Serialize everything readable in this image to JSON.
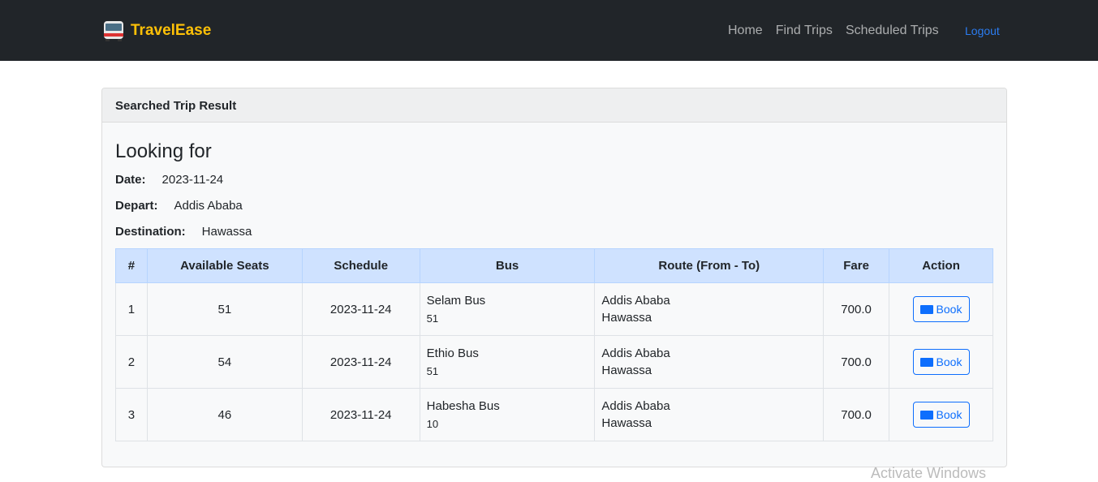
{
  "navbar": {
    "brand": "TravelEase",
    "links": [
      "Home",
      "Find Trips",
      "Scheduled Trips"
    ],
    "logout": "Logout"
  },
  "card": {
    "header": "Searched Trip Result",
    "title": "Looking for",
    "criteria": {
      "date_label": "Date:",
      "date_value": "2023-11-24",
      "depart_label": "Depart:",
      "depart_value": "Addis Ababa",
      "destination_label": "Destination:",
      "destination_value": "Hawassa"
    }
  },
  "table": {
    "headers": [
      "#",
      "Available Seats",
      "Schedule",
      "Bus",
      "Route (From - To)",
      "Fare",
      "Action"
    ],
    "rows": [
      {
        "num": "1",
        "seats": "51",
        "schedule": "2023-11-24",
        "bus": "Selam Bus",
        "bus_sub": "51",
        "from": "Addis Ababa",
        "to": "Hawassa",
        "fare": "700.0",
        "action": "Book"
      },
      {
        "num": "2",
        "seats": "54",
        "schedule": "2023-11-24",
        "bus": "Ethio Bus",
        "bus_sub": "51",
        "from": "Addis Ababa",
        "to": "Hawassa",
        "fare": "700.0",
        "action": "Book"
      },
      {
        "num": "3",
        "seats": "46",
        "schedule": "2023-11-24",
        "bus": "Habesha Bus",
        "bus_sub": "10",
        "from": "Addis Ababa",
        "to": "Hawassa",
        "fare": "700.0",
        "action": "Book"
      }
    ]
  },
  "watermark": "Activate Windows"
}
